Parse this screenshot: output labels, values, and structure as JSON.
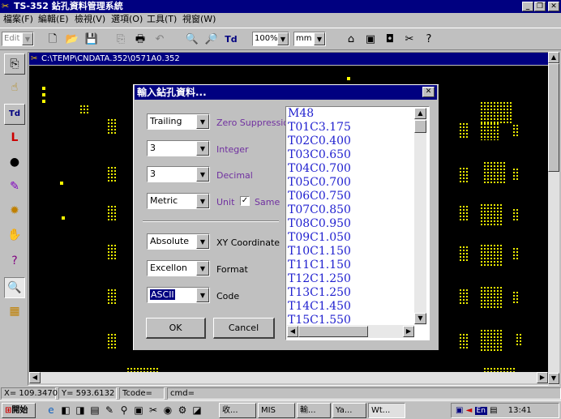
{
  "app": {
    "title": "TS-352 鉆孔資料管理系統"
  },
  "menu": [
    "檔案(F)",
    "編輯(E)",
    "檢視(V)",
    "選項(O)",
    "工具(T)",
    "視窗(W)"
  ],
  "toolbar": {
    "edit_combo": "Edit",
    "zoom": "100%",
    "unit": "mm",
    "text_tool": "Td"
  },
  "child": {
    "title": "C:\\TEMP\\CNDATA.352\\0571A0.352"
  },
  "status": {
    "x": "X= 109.3470",
    "y": "Y= 593.6132",
    "tcode": "Tcode=",
    "cmd": "cmd="
  },
  "taskbar": {
    "start": "開始",
    "tasks": [
      "收...",
      "MIS",
      "輸...",
      "Ya...",
      "Wt..."
    ],
    "tray_lang": "En",
    "clock": "13:41"
  },
  "dialog": {
    "title": "輸入鉆孔資料...",
    "fields": [
      {
        "value": "Trailing",
        "label": "Zero Suppression"
      },
      {
        "value": "3",
        "label": "Integer"
      },
      {
        "value": "3",
        "label": "Decimal"
      },
      {
        "value": "Metric",
        "label": "Unit"
      },
      {
        "value": "Absolute",
        "label": "XY Coordinate"
      },
      {
        "value": "Excellon",
        "label": "Format"
      },
      {
        "value": "ASCII",
        "label": "Code"
      }
    ],
    "same_label": "Same",
    "same_checked": true,
    "ok": "OK",
    "cancel": "Cancel",
    "tools": [
      "M48",
      "T01C3.175",
      "T02C0.400",
      "T03C0.650",
      "T04C0.700",
      "T05C0.700",
      "T06C0.750",
      "T07C0.850",
      "T08C0.950",
      "T09C1.050",
      "T10C1.150",
      "T11C1.150",
      "T12C1.250",
      "T13C1.250",
      "T14C1.450",
      "T15C1.550"
    ]
  },
  "colors": {
    "titlebar": "#000080",
    "canvas": "#000000",
    "drill": "#ffff00",
    "label_purple": "#7030a0",
    "list_text": "#1f1fcf"
  }
}
